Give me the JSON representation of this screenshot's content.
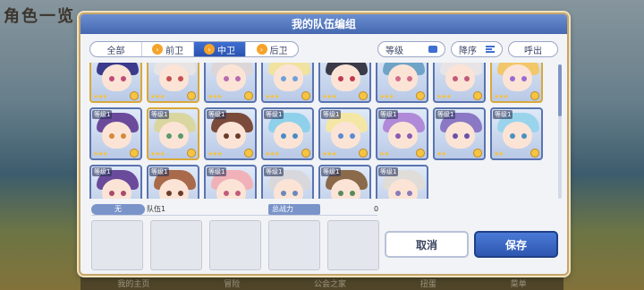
{
  "background": {
    "title": "角色一览",
    "nav_items": [
      "我的主页",
      "冒险",
      "公会之家",
      "扭蛋",
      "菜单"
    ]
  },
  "modal": {
    "title": "我的队伍编组",
    "tabs": [
      {
        "label": "全部",
        "active": false
      },
      {
        "label": "前卫",
        "active": false
      },
      {
        "label": "中卫",
        "active": true
      },
      {
        "label": "后卫",
        "active": false
      }
    ],
    "filter": {
      "level_label": "等级",
      "sort_label": "降序",
      "call_label": "呼出"
    },
    "characters": [
      {
        "level": "",
        "stars": "★★★",
        "hair": "#3b3a8c",
        "eyes": "#c04a7a",
        "border": "gold"
      },
      {
        "level": "",
        "stars": "★★★",
        "hair": "#e9e4e4",
        "eyes": "#c45050",
        "border": "gold"
      },
      {
        "level": "",
        "stars": "★★★",
        "hair": "#dcd6d8",
        "eyes": "#b76bb0",
        "border": "blue"
      },
      {
        "level": "",
        "stars": "★★★",
        "hair": "#f1e2a0",
        "eyes": "#6ea0d8",
        "border": "blue"
      },
      {
        "level": "",
        "stars": "★★★",
        "hair": "#3a3a48",
        "eyes": "#c03a50",
        "border": "blue"
      },
      {
        "level": "",
        "stars": "★★★",
        "hair": "#6fa3c8",
        "eyes": "#d46a8c",
        "border": "blue"
      },
      {
        "level": "",
        "stars": "★★★",
        "hair": "#e8e4e6",
        "eyes": "#c05a7a",
        "border": "blue"
      },
      {
        "level": "",
        "stars": "★★★",
        "hair": "#f2c76a",
        "eyes": "#9a6ad0",
        "border": "gold"
      },
      {
        "level": "等级1",
        "stars": "★★★",
        "hair": "#6b4a9c",
        "eyes": "#d48a3a",
        "border": "blue"
      },
      {
        "level": "等级1",
        "stars": "★★★",
        "hair": "#d9d6a0",
        "eyes": "#5a9a6a",
        "border": "gold"
      },
      {
        "level": "等级1",
        "stars": "★★★",
        "hair": "#7a4a3a",
        "eyes": "#6a3a2a",
        "border": "blue"
      },
      {
        "level": "等级1",
        "stars": "★★★",
        "hair": "#8fd0ea",
        "eyes": "#4a8ac8",
        "border": "blue"
      },
      {
        "level": "等级1",
        "stars": "★★★",
        "hair": "#f4e7a6",
        "eyes": "#5a8ad0",
        "border": "blue"
      },
      {
        "level": "等级1",
        "stars": "★★",
        "hair": "#b08ad8",
        "eyes": "#8a5ab0",
        "border": "blue"
      },
      {
        "level": "等级1",
        "stars": "★★",
        "hair": "#8a78c4",
        "eyes": "#6a50a8",
        "border": "blue"
      },
      {
        "level": "等级1",
        "stars": "★★",
        "hair": "#9ad4ec",
        "eyes": "#4a90c0",
        "border": "blue"
      },
      {
        "level": "等级1",
        "stars": "★★",
        "hair": "#6a4a9a",
        "eyes": "#a84a6a",
        "border": "blue"
      },
      {
        "level": "等级1",
        "stars": "★★",
        "hair": "#a86a4a",
        "eyes": "#6a3a2a",
        "border": "blue"
      },
      {
        "level": "等级1",
        "stars": "★★",
        "hair": "#f0b2b8",
        "eyes": "#c45a7a",
        "border": "blue"
      },
      {
        "level": "等级1",
        "stars": "★★",
        "hair": "#d8d8dc",
        "eyes": "#6a88b8",
        "border": "blue"
      },
      {
        "level": "等级1",
        "stars": "★★",
        "hair": "#8a6a4a",
        "eyes": "#5a8a5a",
        "border": "blue"
      },
      {
        "level": "等级1",
        "stars": "★★",
        "hair": "#e0dcd8",
        "eyes": "#8a7ab8",
        "border": "blue"
      }
    ],
    "team": {
      "label": "无",
      "name": "队伍1",
      "power_label": "总战力",
      "power_value": "0",
      "slots": 5
    },
    "buttons": {
      "cancel": "取消",
      "save": "保存"
    }
  }
}
